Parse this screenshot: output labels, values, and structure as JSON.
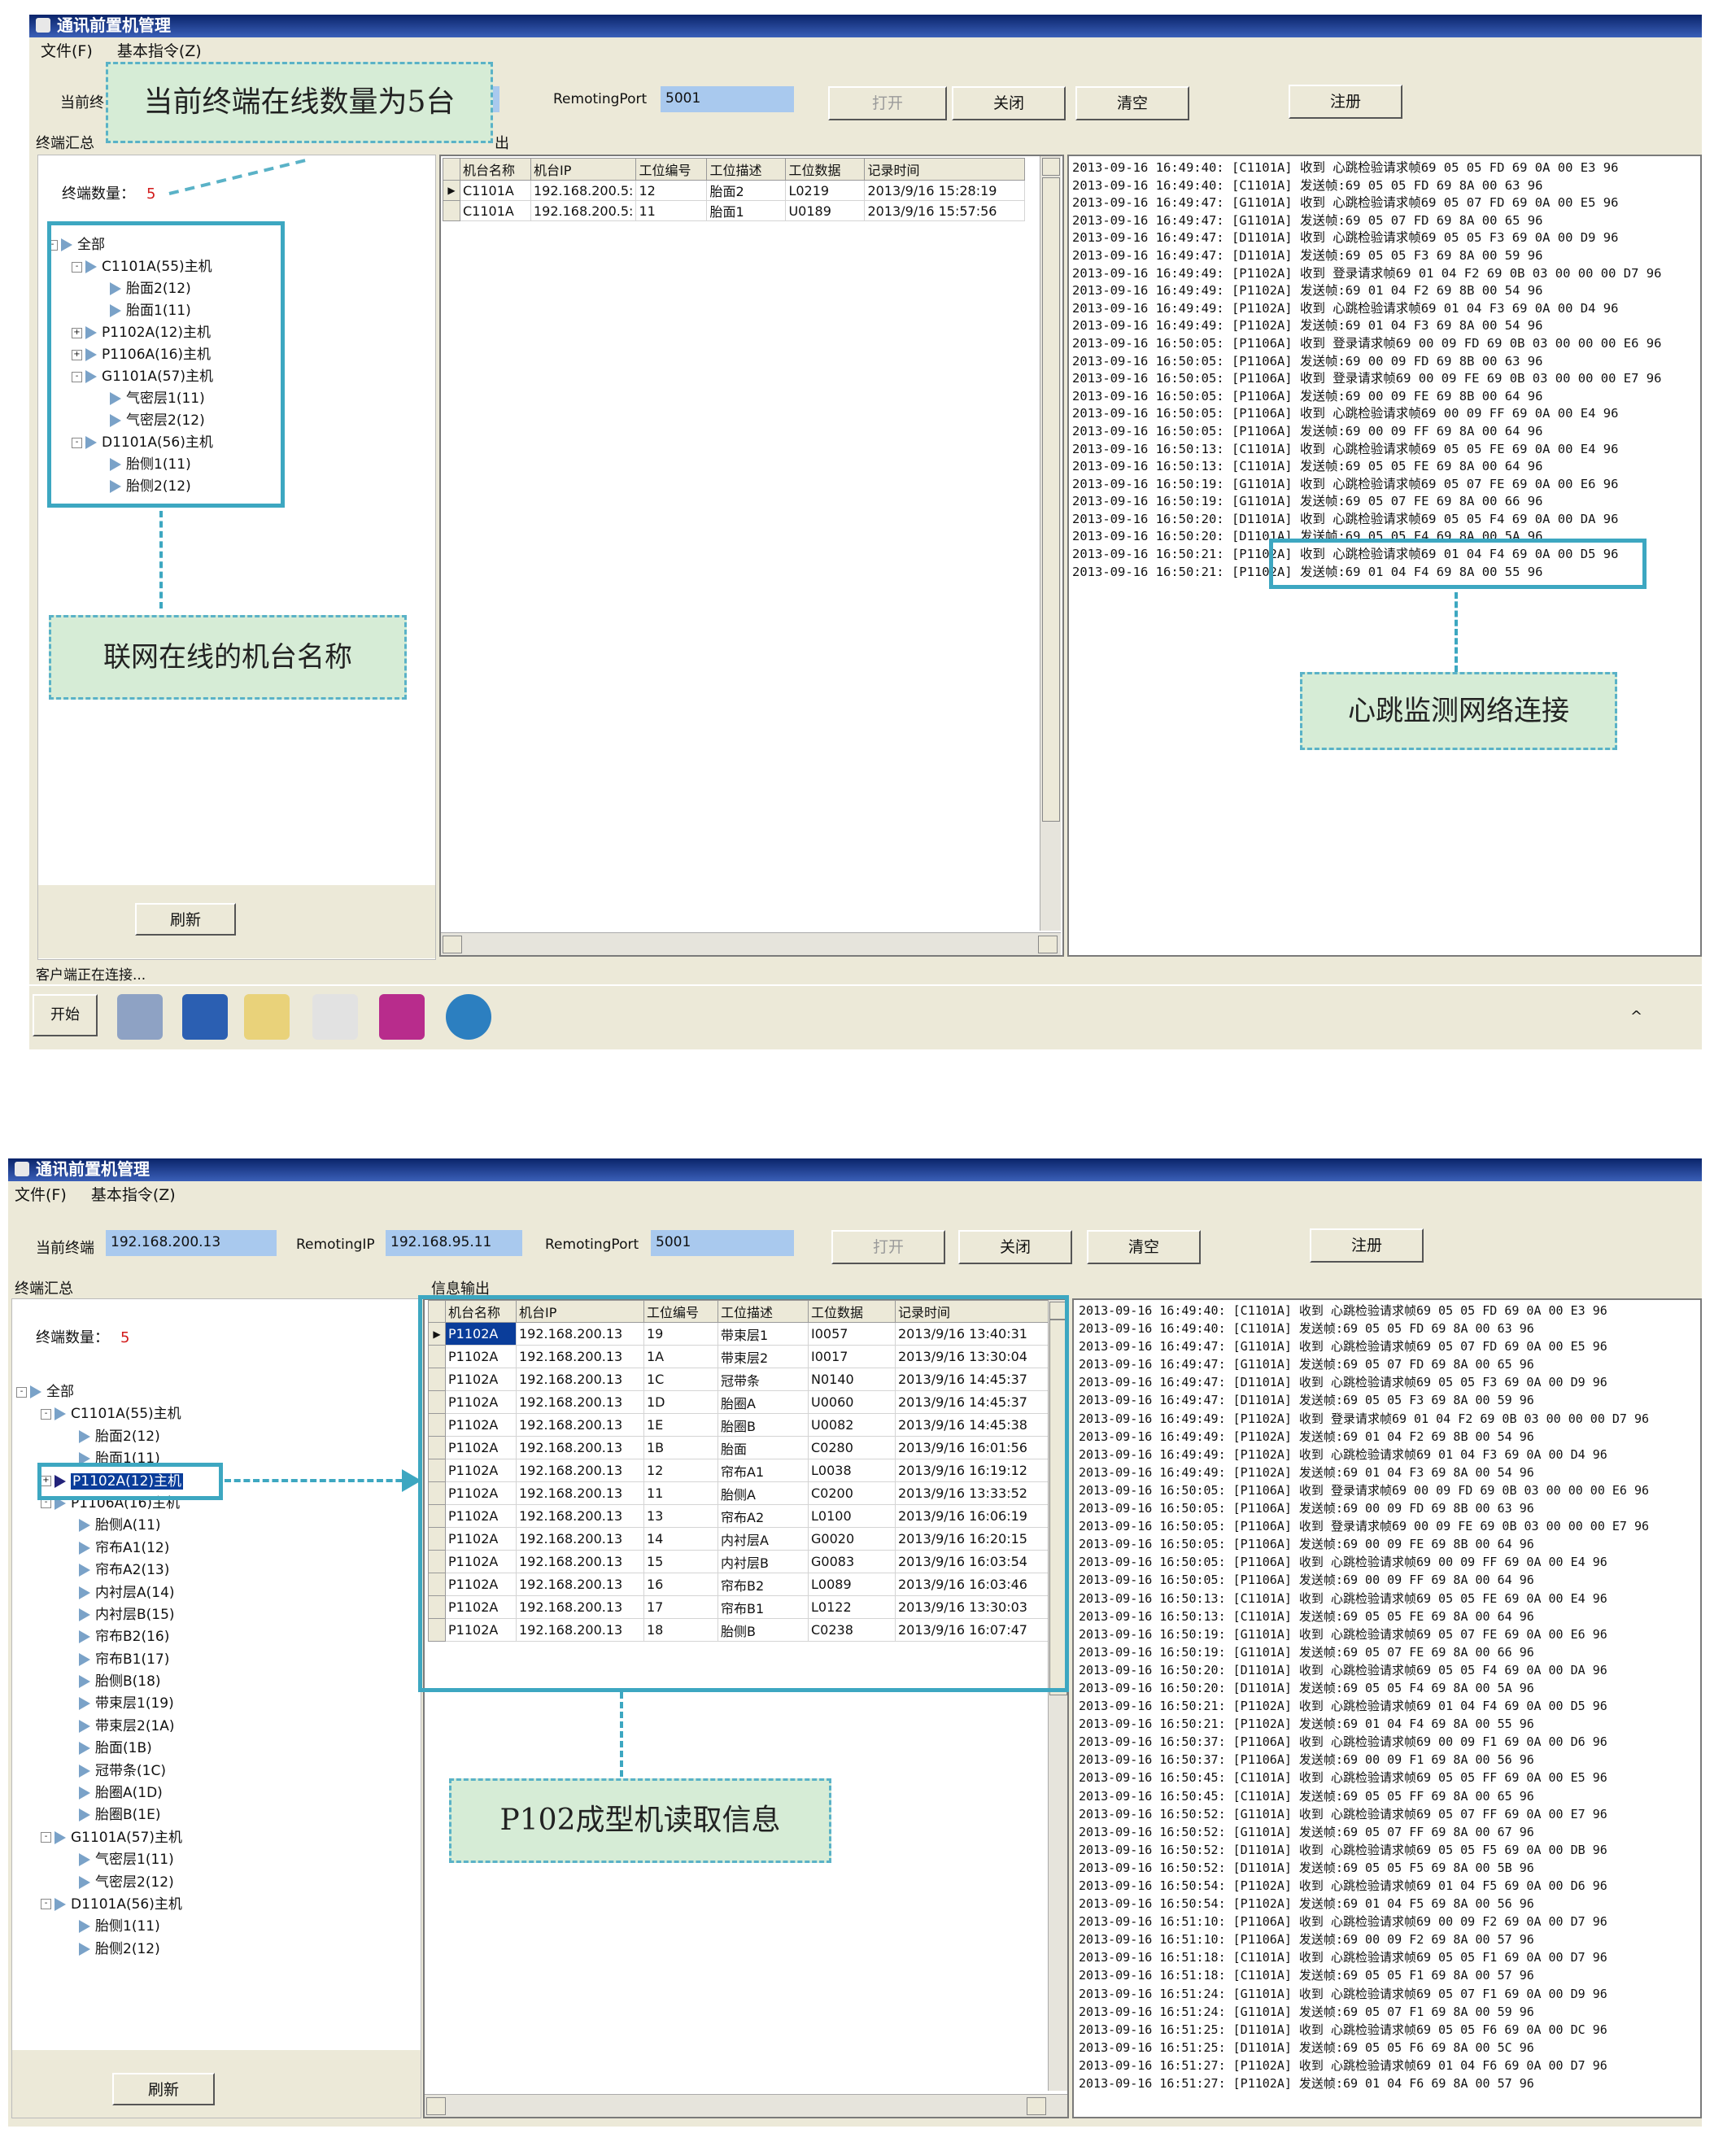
{
  "screen1": {
    "window_title": "通讯前置机管理",
    "menu": [
      "文件(F)",
      "基本指令(Z)"
    ],
    "current_terminal_label": "当前终",
    "remoting_port_label": "RemotingPort",
    "remoting_port_value": "5001",
    "buttons": {
      "open": "打开",
      "close": "关闭",
      "clear": "清空",
      "register": "注册"
    },
    "summary_group": "终端汇总",
    "output_group_fragment": "出",
    "terminal_count_label": "终端数量：",
    "terminal_count_value": "5",
    "tree": [
      {
        "label": "全部",
        "level": 0,
        "expander": "-"
      },
      {
        "label": "C1101A(55)主机",
        "level": 1,
        "expander": "-"
      },
      {
        "label": "胎面2(12)",
        "level": 2,
        "expander": ""
      },
      {
        "label": "胎面1(11)",
        "level": 2,
        "expander": ""
      },
      {
        "label": "P1102A(12)主机",
        "level": 1,
        "expander": "+"
      },
      {
        "label": "P1106A(16)主机",
        "level": 1,
        "expander": "+"
      },
      {
        "label": "G1101A(57)主机",
        "level": 1,
        "expander": "-"
      },
      {
        "label": "气密层1(11)",
        "level": 2,
        "expander": ""
      },
      {
        "label": "气密层2(12)",
        "level": 2,
        "expander": ""
      },
      {
        "label": "D1101A(56)主机",
        "level": 1,
        "expander": "-"
      },
      {
        "label": "胎侧1(11)",
        "level": 2,
        "expander": ""
      },
      {
        "label": "胎侧2(12)",
        "level": 2,
        "expander": ""
      }
    ],
    "refresh_button": "刷新",
    "table": {
      "headers": [
        "机台名称",
        "机台IP",
        "工位编号",
        "工位描述",
        "工位数据",
        "记录时间"
      ],
      "rows": [
        [
          "C1101A",
          "192.168.200.5:",
          "12",
          "胎面2",
          "L0219",
          "2013/9/16 15:28:19"
        ],
        [
          "C1101A",
          "192.168.200.5:",
          "11",
          "胎面1",
          "U0189",
          "2013/9/16 15:57:56"
        ]
      ]
    },
    "log": [
      "2013-09-16 16:49:40: [C1101A] 收到 心跳检验请求帧69 05 05 FD 69 0A 00 E3 96",
      "2013-09-16 16:49:40: [C1101A] 发送帧:69 05 05 FD 69 8A 00 63 96",
      "2013-09-16 16:49:47: [G1101A] 收到 心跳检验请求帧69 05 07 FD 69 0A 00 E5 96",
      "2013-09-16 16:49:47: [G1101A] 发送帧:69 05 07 FD 69 8A 00 65 96",
      "2013-09-16 16:49:47: [D1101A] 收到 心跳检验请求帧69 05 05 F3 69 0A 00 D9 96",
      "2013-09-16 16:49:47: [D1101A] 发送帧:69 05 05 F3 69 8A 00 59 96",
      "2013-09-16 16:49:49: [P1102A] 收到 登录请求帧69 01 04 F2 69 0B 03 00 00 00 D7 96",
      "2013-09-16 16:49:49: [P1102A] 发送帧:69 01 04 F2 69 8B 00 54 96",
      "2013-09-16 16:49:49: [P1102A] 收到 心跳检验请求帧69 01 04 F3 69 0A 00 D4 96",
      "2013-09-16 16:49:49: [P1102A] 发送帧:69 01 04 F3 69 8A 00 54 96",
      "2013-09-16 16:50:05: [P1106A] 收到 登录请求帧69 00 09 FD 69 0B 03 00 00 00 E6 96",
      "2013-09-16 16:50:05: [P1106A] 发送帧:69 00 09 FD 69 8B 00 63 96",
      "2013-09-16 16:50:05: [P1106A] 收到 登录请求帧69 00 09 FE 69 0B 03 00 00 00 E7 96",
      "2013-09-16 16:50:05: [P1106A] 发送帧:69 00 09 FE 69 8B 00 64 96",
      "2013-09-16 16:50:05: [P1106A] 收到 心跳检验请求帧69 00 09 FF 69 0A 00 E4 96",
      "2013-09-16 16:50:05: [P1106A] 发送帧:69 00 09 FF 69 8A 00 64 96",
      "2013-09-16 16:50:13: [C1101A] 收到 心跳检验请求帧69 05 05 FE 69 0A 00 E4 96",
      "2013-09-16 16:50:13: [C1101A] 发送帧:69 05 05 FE 69 8A 00 64 96",
      "2013-09-16 16:50:19: [G1101A] 收到 心跳检验请求帧69 05 07 FE 69 0A 00 E6 96",
      "2013-09-16 16:50:19: [G1101A] 发送帧:69 05 07 FE 69 8A 00 66 96",
      "2013-09-16 16:50:20: [D1101A] 收到 心跳检验请求帧69 05 05 F4 69 0A 00 DA 96",
      "2013-09-16 16:50:20: [D1101A] 发送帧:69 05 05 F4 69 8A 00 5A 96",
      "2013-09-16 16:50:21: [P1102A] 收到 心跳检验请求帧69 01 04 F4 69 0A 00 D5 96",
      "2013-09-16 16:50:21: [P1102A] 发送帧:69 01 04 F4 69 8A 00 55 96"
    ],
    "status": "客户端正在连接...",
    "taskbar_start": "开始",
    "taskbar_ime": "^",
    "callouts": {
      "online_count": "当前终端在线数量为5台",
      "machine_names": "联网在线的机台名称",
      "heartbeat": "心跳监测网络连接"
    }
  },
  "screen2": {
    "window_title": "通讯前置机管理",
    "menu": [
      "文件(F)",
      "基本指令(Z)"
    ],
    "current_terminal_label": "当前终端",
    "current_terminal_value": "192.168.200.13",
    "remoting_ip_label": "RemotingIP",
    "remoting_ip_value": "192.168.95.11",
    "remoting_port_label": "RemotingPort",
    "remoting_port_value": "5001",
    "buttons": {
      "open": "打开",
      "close": "关闭",
      "clear": "清空",
      "register": "注册"
    },
    "summary_group": "终端汇总",
    "output_group": "信息输出",
    "terminal_count_label": "终端数量：",
    "terminal_count_value": "5",
    "tree": [
      {
        "label": "全部",
        "level": 0,
        "expander": "-"
      },
      {
        "label": "C1101A(55)主机",
        "level": 1,
        "expander": "-"
      },
      {
        "label": "胎面2(12)",
        "level": 2,
        "expander": ""
      },
      {
        "label": "胎面1(11)",
        "level": 2,
        "expander": ""
      },
      {
        "label": "P1102A(12)主机",
        "level": 1,
        "expander": "+"
      },
      {
        "label": "P1106A(16)主机",
        "level": 1,
        "expander": "-"
      },
      {
        "label": "胎侧A(11)",
        "level": 2,
        "expander": ""
      },
      {
        "label": "帘布A1(12)",
        "level": 2,
        "expander": ""
      },
      {
        "label": "帘布A2(13)",
        "level": 2,
        "expander": ""
      },
      {
        "label": "内衬层A(14)",
        "level": 2,
        "expander": ""
      },
      {
        "label": "内衬层B(15)",
        "level": 2,
        "expander": ""
      },
      {
        "label": "帘布B2(16)",
        "level": 2,
        "expander": ""
      },
      {
        "label": "帘布B1(17)",
        "level": 2,
        "expander": ""
      },
      {
        "label": "胎侧B(18)",
        "level": 2,
        "expander": ""
      },
      {
        "label": "带束层1(19)",
        "level": 2,
        "expander": ""
      },
      {
        "label": "带束层2(1A)",
        "level": 2,
        "expander": ""
      },
      {
        "label": "胎面(1B)",
        "level": 2,
        "expander": ""
      },
      {
        "label": "冠带条(1C)",
        "level": 2,
        "expander": ""
      },
      {
        "label": "胎圈A(1D)",
        "level": 2,
        "expander": ""
      },
      {
        "label": "胎圈B(1E)",
        "level": 2,
        "expander": ""
      },
      {
        "label": "G1101A(57)主机",
        "level": 1,
        "expander": "-"
      },
      {
        "label": "气密层1(11)",
        "level": 2,
        "expander": ""
      },
      {
        "label": "气密层2(12)",
        "level": 2,
        "expander": ""
      },
      {
        "label": "D1101A(56)主机",
        "level": 1,
        "expander": "-"
      },
      {
        "label": "胎侧1(11)",
        "level": 2,
        "expander": ""
      },
      {
        "label": "胎侧2(12)",
        "level": 2,
        "expander": ""
      }
    ],
    "refresh_button": "刷新",
    "table": {
      "headers": [
        "机台名称",
        "机台IP",
        "工位编号",
        "工位描述",
        "工位数据",
        "记录时间"
      ],
      "rows": [
        [
          "P1102A",
          "192.168.200.13",
          "19",
          "带束层1",
          "I0057",
          "2013/9/16 13:40:31"
        ],
        [
          "P1102A",
          "192.168.200.13",
          "1A",
          "带束层2",
          "I0017",
          "2013/9/16 13:30:04"
        ],
        [
          "P1102A",
          "192.168.200.13",
          "1C",
          "冠带条",
          "N0140",
          "2013/9/16 14:45:37"
        ],
        [
          "P1102A",
          "192.168.200.13",
          "1D",
          "胎圈A",
          "U0060",
          "2013/9/16 14:45:37"
        ],
        [
          "P1102A",
          "192.168.200.13",
          "1E",
          "胎圈B",
          "U0082",
          "2013/9/16 14:45:38"
        ],
        [
          "P1102A",
          "192.168.200.13",
          "1B",
          "胎面",
          "C0280",
          "2013/9/16 16:01:56"
        ],
        [
          "P1102A",
          "192.168.200.13",
          "12",
          "帘布A1",
          "L0038",
          "2013/9/16 16:19:12"
        ],
        [
          "P1102A",
          "192.168.200.13",
          "11",
          "胎侧A",
          "C0200",
          "2013/9/16 13:33:52"
        ],
        [
          "P1102A",
          "192.168.200.13",
          "13",
          "帘布A2",
          "L0100",
          "2013/9/16 16:06:19"
        ],
        [
          "P1102A",
          "192.168.200.13",
          "14",
          "内衬层A",
          "G0020",
          "2013/9/16 16:20:15"
        ],
        [
          "P1102A",
          "192.168.200.13",
          "15",
          "内衬层B",
          "G0083",
          "2013/9/16 16:03:54"
        ],
        [
          "P1102A",
          "192.168.200.13",
          "16",
          "帘布B2",
          "L0089",
          "2013/9/16 16:03:46"
        ],
        [
          "P1102A",
          "192.168.200.13",
          "17",
          "帘布B1",
          "L0122",
          "2013/9/16 13:30:03"
        ],
        [
          "P1102A",
          "192.168.200.13",
          "18",
          "胎侧B",
          "C0238",
          "2013/9/16 16:07:47"
        ]
      ]
    },
    "log": [
      "2013-09-16 16:49:40: [C1101A] 收到 心跳检验请求帧69 05 05 FD 69 0A 00 E3 96",
      "2013-09-16 16:49:40: [C1101A] 发送帧:69 05 05 FD 69 8A 00 63 96",
      "2013-09-16 16:49:47: [G1101A] 收到 心跳检验请求帧69 05 07 FD 69 0A 00 E5 96",
      "2013-09-16 16:49:47: [G1101A] 发送帧:69 05 07 FD 69 8A 00 65 96",
      "2013-09-16 16:49:47: [D1101A] 收到 心跳检验请求帧69 05 05 F3 69 0A 00 D9 96",
      "2013-09-16 16:49:47: [D1101A] 发送帧:69 05 05 F3 69 8A 00 59 96",
      "2013-09-16 16:49:49: [P1102A] 收到 登录请求帧69 01 04 F2 69 0B 03 00 00 00 D7 96",
      "2013-09-16 16:49:49: [P1102A] 发送帧:69 01 04 F2 69 8B 00 54 96",
      "2013-09-16 16:49:49: [P1102A] 收到 心跳检验请求帧69 01 04 F3 69 0A 00 D4 96",
      "2013-09-16 16:49:49: [P1102A] 发送帧:69 01 04 F3 69 8A 00 54 96",
      "2013-09-16 16:50:05: [P1106A] 收到 登录请求帧69 00 09 FD 69 0B 03 00 00 00 E6 96",
      "2013-09-16 16:50:05: [P1106A] 发送帧:69 00 09 FD 69 8B 00 63 96",
      "2013-09-16 16:50:05: [P1106A] 收到 登录请求帧69 00 09 FE 69 0B 03 00 00 00 E7 96",
      "2013-09-16 16:50:05: [P1106A] 发送帧:69 00 09 FE 69 8B 00 64 96",
      "2013-09-16 16:50:05: [P1106A] 收到 心跳检验请求帧69 00 09 FF 69 0A 00 E4 96",
      "2013-09-16 16:50:05: [P1106A] 发送帧:69 00 09 FF 69 8A 00 64 96",
      "2013-09-16 16:50:13: [C1101A] 收到 心跳检验请求帧69 05 05 FE 69 0A 00 E4 96",
      "2013-09-16 16:50:13: [C1101A] 发送帧:69 05 05 FE 69 8A 00 64 96",
      "2013-09-16 16:50:19: [G1101A] 收到 心跳检验请求帧69 05 07 FE 69 0A 00 E6 96",
      "2013-09-16 16:50:19: [G1101A] 发送帧:69 05 07 FE 69 8A 00 66 96",
      "2013-09-16 16:50:20: [D1101A] 收到 心跳检验请求帧69 05 05 F4 69 0A 00 DA 96",
      "2013-09-16 16:50:20: [D1101A] 发送帧:69 05 05 F4 69 8A 00 5A 96",
      "2013-09-16 16:50:21: [P1102A] 收到 心跳检验请求帧69 01 04 F4 69 0A 00 D5 96",
      "2013-09-16 16:50:21: [P1102A] 发送帧:69 01 04 F4 69 8A 00 55 96",
      "2013-09-16 16:50:37: [P1106A] 收到 心跳检验请求帧69 00 09 F1 69 0A 00 D6 96",
      "2013-09-16 16:50:37: [P1106A] 发送帧:69 00 09 F1 69 8A 00 56 96",
      "2013-09-16 16:50:45: [C1101A] 收到 心跳检验请求帧69 05 05 FF 69 0A 00 E5 96",
      "2013-09-16 16:50:45: [C1101A] 发送帧:69 05 05 FF 69 8A 00 65 96",
      "2013-09-16 16:50:52: [G1101A] 收到 心跳检验请求帧69 05 07 FF 69 0A 00 E7 96",
      "2013-09-16 16:50:52: [G1101A] 发送帧:69 05 07 FF 69 8A 00 67 96",
      "2013-09-16 16:50:52: [D1101A] 收到 心跳检验请求帧69 05 05 F5 69 0A 00 DB 96",
      "2013-09-16 16:50:52: [D1101A] 发送帧:69 05 05 F5 69 8A 00 5B 96",
      "2013-09-16 16:50:54: [P1102A] 收到 心跳检验请求帧69 01 04 F5 69 0A 00 D6 96",
      "2013-09-16 16:50:54: [P1102A] 发送帧:69 01 04 F5 69 8A 00 56 96",
      "2013-09-16 16:51:10: [P1106A] 收到 心跳检验请求帧69 00 09 F2 69 0A 00 D7 96",
      "2013-09-16 16:51:10: [P1106A] 发送帧:69 00 09 F2 69 8A 00 57 96",
      "2013-09-16 16:51:18: [C1101A] 收到 心跳检验请求帧69 05 05 F1 69 0A 00 D7 96",
      "2013-09-16 16:51:18: [C1101A] 发送帧:69 05 05 F1 69 8A 00 57 96",
      "2013-09-16 16:51:24: [G1101A] 收到 心跳检验请求帧69 05 07 F1 69 0A 00 D9 96",
      "2013-09-16 16:51:24: [G1101A] 发送帧:69 05 07 F1 69 8A 00 59 96",
      "2013-09-16 16:51:25: [D1101A] 收到 心跳检验请求帧69 05 05 F6 69 0A 00 DC 96",
      "2013-09-16 16:51:25: [D1101A] 发送帧:69 05 05 F6 69 8A 00 5C 96",
      "2013-09-16 16:51:27: [P1102A] 收到 心跳检验请求帧69 01 04 F6 69 0A 00 D7 96",
      "2013-09-16 16:51:27: [P1102A] 发送帧:69 01 04 F6 69 8A 00 57 96"
    ],
    "callouts": {
      "read_info": "P102成型机读取信息"
    }
  },
  "colors": {
    "titlebar": "#0a246a",
    "field_bg": "#a9c9ee",
    "highlight_box": "#3da7c1",
    "callout_bg": "#d6ecd6",
    "count_red": "#d21b1b",
    "selection": "#0a3d9a"
  }
}
